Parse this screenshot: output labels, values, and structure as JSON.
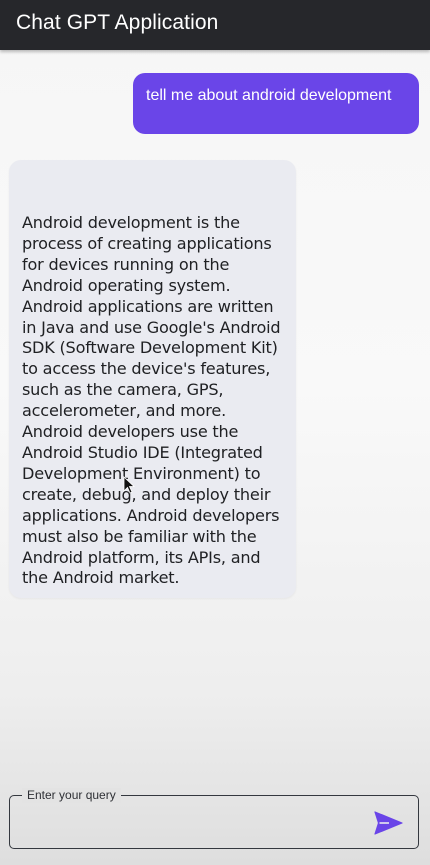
{
  "app": {
    "title": "Chat GPT Application"
  },
  "messages": [
    {
      "role": "user",
      "text": "tell me about android development"
    },
    {
      "role": "assistant",
      "text": "Android development is the process of creating applications for devices running on the Android operating system. Android applications are written in Java and use Google's Android SDK (Software Development Kit) to access the device's features, such as the camera, GPS, accelerometer, and more. Android developers use the Android Studio IDE (Integrated Development Environment) to create, debug, and deploy their applications. Android developers must also be familiar with the Android platform, its APIs, and the Android market."
    }
  ],
  "composer": {
    "label": "Enter your query",
    "value": ""
  },
  "colors": {
    "appbar": "#26272b",
    "user_bubble": "#6a45e8",
    "assistant_bubble": "#eaebf1",
    "send_icon": "#6a45e8"
  },
  "icons": {
    "send": "send-icon",
    "pointer": "mouse-pointer-icon"
  }
}
